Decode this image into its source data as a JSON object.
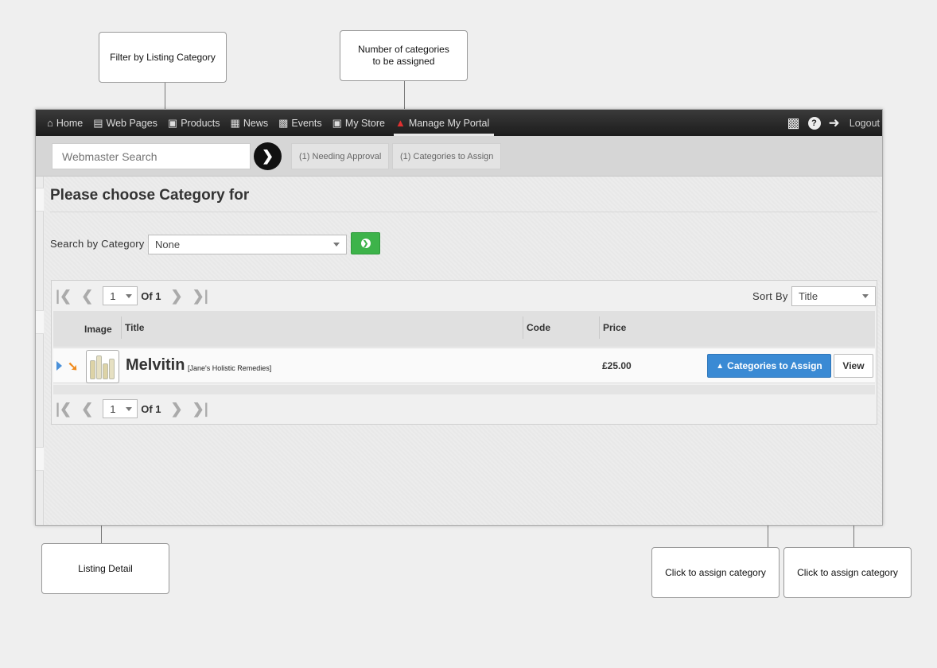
{
  "callouts": {
    "filter": "Filter by Listing Category",
    "count_line1": "Number of categories",
    "count_line2": "to be assigned",
    "listing_detail": "Listing Detail",
    "assign1": "Click to assign category",
    "assign2": "Click to assign category"
  },
  "nav": {
    "items": [
      {
        "label": "Home",
        "icon": "home-icon"
      },
      {
        "label": "Web Pages",
        "icon": "web-pages-icon"
      },
      {
        "label": "Products",
        "icon": "image-icon"
      },
      {
        "label": "News",
        "icon": "newspaper-icon"
      },
      {
        "label": "Events",
        "icon": "calendar-icon"
      },
      {
        "label": "My Store",
        "icon": "cart-icon"
      },
      {
        "label": "Manage My Portal",
        "icon": "sitemap-icon",
        "active": true
      }
    ],
    "right": {
      "calendar_icon": "calendar-icon",
      "help_icon": "help-icon",
      "logout_icon": "logout-icon",
      "logout_label": "Logout"
    }
  },
  "toolbar": {
    "search_placeholder": "Webmaster Search",
    "needing_approval": "(1) Needing Approval",
    "categories_to_assign": "(1) Categories to Assign"
  },
  "main": {
    "title": "Please choose Category for",
    "search_label": "Search by Category",
    "category_selected": "None"
  },
  "pager": {
    "page": "1",
    "of_label": "Of",
    "total": "1",
    "sort_label": "Sort By",
    "sort_value": "Title"
  },
  "table": {
    "headers": {
      "image": "Image",
      "title": "Title",
      "code": "Code",
      "price": "Price"
    },
    "rows": [
      {
        "title": "Melvitin",
        "store": "[Jane's Holistic Remedies]",
        "code": "",
        "price": "£25.00",
        "assign_label": "Categories to Assign",
        "view_label": "View"
      }
    ]
  },
  "colors": {
    "accent_blue": "#3a8ad4",
    "accent_green": "#3db34a",
    "nav_bg": "#222222",
    "active_icon": "#e03030"
  }
}
